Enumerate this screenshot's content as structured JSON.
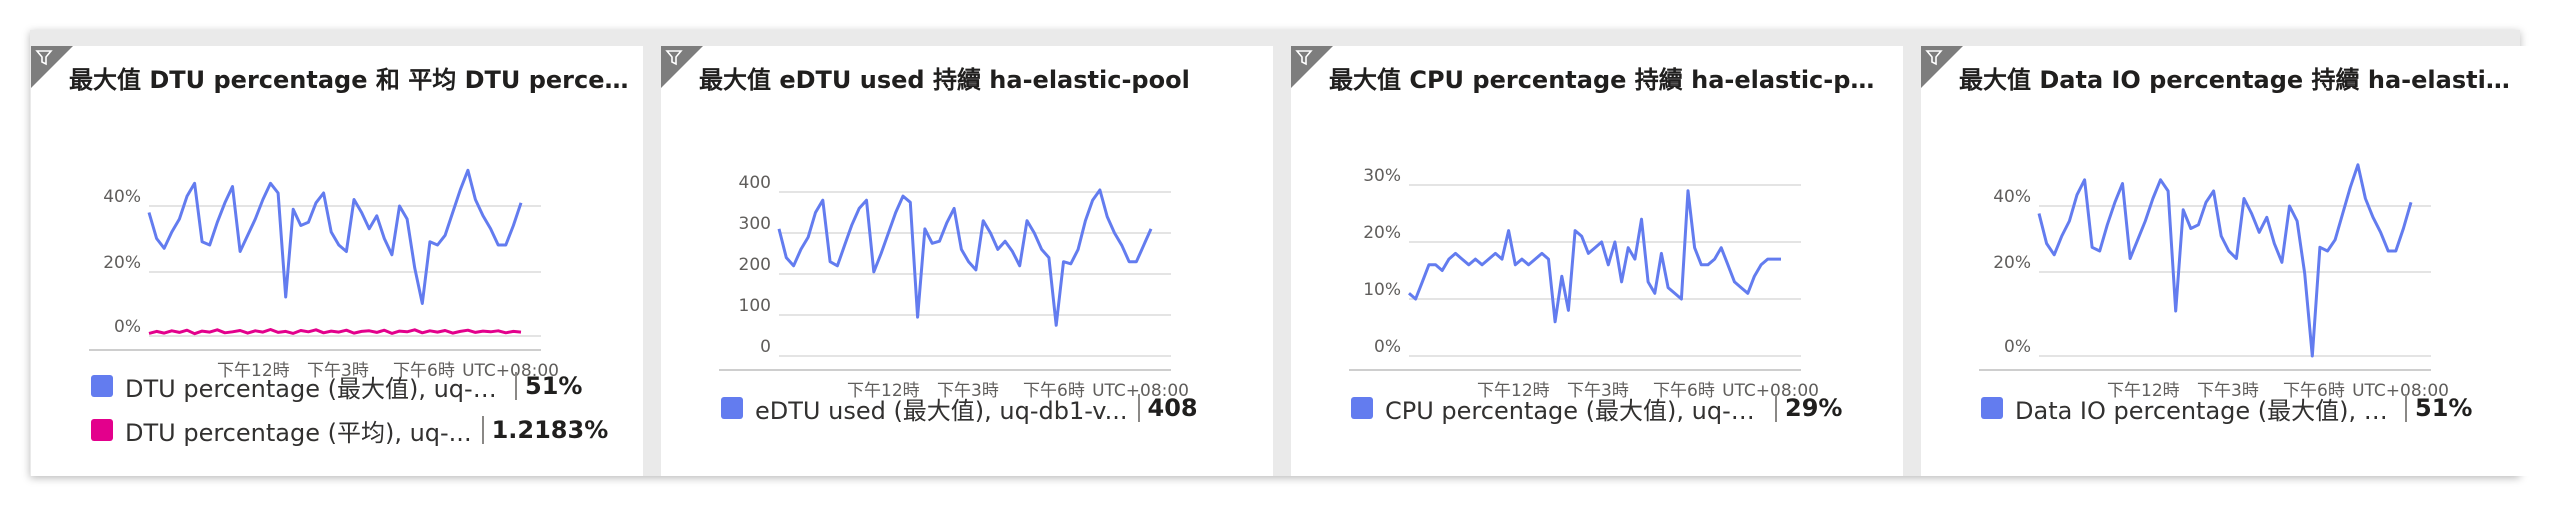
{
  "colors": {
    "series_max": "#637cef",
    "series_avg": "#e3008c",
    "grid": "#dcdcdc",
    "axis": "#bdbdbd",
    "tick": "#605e5c"
  },
  "icons": {
    "tile_filter": "filter-icon"
  },
  "tiles": [
    {
      "title": "最大值 DTU percentage 和 平均 DTU percen...",
      "legend": [
        {
          "name": "DTU percentage (最大值), uq-d...",
          "value": "51%",
          "color": "#637cef"
        },
        {
          "name": "DTU percentage (平均), uq-...",
          "value": "1.2183%",
          "color": "#e3008c"
        }
      ],
      "y_ticks": [
        "40%",
        "20%",
        "0%"
      ],
      "x_ticks": [
        "下午12時",
        "下午3時",
        "下午6時"
      ],
      "timezone": "UTC+08:00"
    },
    {
      "title": "最大值 eDTU used 持續 ha-elastic-pool",
      "legend": [
        {
          "name": "eDTU used (最大值), uq-db1-v...",
          "value": "408",
          "color": "#637cef"
        }
      ],
      "y_ticks": [
        "400",
        "300",
        "200",
        "100",
        "0"
      ],
      "x_ticks": [
        "下午12時",
        "下午3時",
        "下午6時"
      ],
      "timezone": "UTC+08:00"
    },
    {
      "title": "最大值 CPU percentage 持續 ha-elastic-pool",
      "legend": [
        {
          "name": "CPU percentage (最大值), uq-d...",
          "value": "29%",
          "color": "#637cef"
        }
      ],
      "y_ticks": [
        "30%",
        "20%",
        "10%",
        "0%"
      ],
      "x_ticks": [
        "下午12時",
        "下午3時",
        "下午6時"
      ],
      "timezone": "UTC+08:00"
    },
    {
      "title": "最大值 Data IO percentage 持續 ha-elastic-...",
      "legend": [
        {
          "name": "Data IO percentage (最大值), u...",
          "value": "51%",
          "color": "#637cef"
        }
      ],
      "y_ticks": [
        "40%",
        "20%",
        "0%"
      ],
      "x_ticks": [
        "下午12時",
        "下午3時",
        "下午6時"
      ],
      "timezone": "UTC+08:00"
    }
  ],
  "chart_data": [
    {
      "type": "line",
      "title": "最大值 DTU percentage 和 平均 DTU percen...",
      "ylim": [
        0,
        50
      ],
      "series": [
        {
          "name": "DTU percentage (最大值), uq-d...",
          "values": [
            38,
            30,
            27,
            32,
            36,
            43,
            47,
            29,
            28,
            35,
            41,
            46,
            26,
            31,
            36,
            42,
            47,
            44,
            12,
            39,
            34,
            35,
            41,
            44,
            32,
            28,
            26,
            42,
            38,
            33,
            37,
            30,
            25,
            40,
            36,
            21,
            10,
            29,
            28,
            31,
            38,
            45,
            51,
            42,
            37,
            33,
            28,
            28,
            34,
            41
          ]
        },
        {
          "name": "DTU percentage (平均), uq-...",
          "values": [
            0.8,
            1.4,
            0.9,
            1.6,
            1.1,
            1.8,
            0.7,
            1.5,
            1.2,
            1.9,
            1.0,
            1.3,
            1.7,
            0.9,
            1.6,
            1.2,
            2.0,
            1.1,
            1.4,
            0.8,
            1.7,
            1.3,
            1.9,
            1.0,
            1.5,
            1.2,
            1.8,
            0.9,
            1.4,
            1.6,
            1.1,
            1.8,
            0.8,
            1.5,
            1.3,
            1.9,
            1.0,
            1.6,
            1.2,
            1.7,
            0.9,
            1.4,
            1.8,
            1.1,
            1.5,
            1.3,
            1.6,
            1.0,
            1.4,
            1.2
          ]
        }
      ]
    },
    {
      "type": "line",
      "title": "最大值 eDTU used 持續 ha-elastic-pool",
      "ylim": [
        0,
        400
      ],
      "series": [
        {
          "name": "eDTU used (最大值), uq-db1-v...",
          "values": [
            310,
            240,
            220,
            260,
            290,
            350,
            380,
            230,
            220,
            270,
            320,
            360,
            380,
            205,
            250,
            300,
            350,
            390,
            375,
            95,
            310,
            275,
            280,
            325,
            360,
            260,
            230,
            210,
            330,
            300,
            260,
            280,
            255,
            220,
            330,
            300,
            260,
            240,
            75,
            230,
            225,
            260,
            330,
            380,
            405,
            340,
            300,
            270,
            230,
            230,
            270,
            310
          ]
        }
      ]
    },
    {
      "type": "line",
      "title": "最大值 CPU percentage 持續 ha-elastic-pool",
      "ylim": [
        0,
        30
      ],
      "series": [
        {
          "name": "CPU percentage (最大值), uq-d...",
          "values": [
            11,
            10,
            13,
            16,
            16,
            15,
            17,
            18,
            17,
            16,
            17,
            16,
            17,
            18,
            17,
            22,
            16,
            17,
            16,
            17,
            18,
            17,
            6,
            14,
            8,
            22,
            21,
            18,
            19,
            20,
            16,
            20,
            13,
            19,
            17,
            24,
            13,
            11,
            18,
            12,
            11,
            10,
            29,
            19,
            16,
            16,
            17,
            19,
            16,
            13,
            12,
            11,
            14,
            16,
            17,
            17,
            17
          ]
        }
      ]
    },
    {
      "type": "line",
      "title": "最大值 Data IO percentage 持續 ha-elastic-...",
      "ylim": [
        0,
        50
      ],
      "series": [
        {
          "name": "Data IO percentage (最大值), u...",
          "values": [
            38,
            30,
            27,
            32,
            36,
            43,
            47,
            29,
            28,
            35,
            41,
            46,
            26,
            31,
            36,
            42,
            47,
            44,
            12,
            39,
            34,
            35,
            41,
            44,
            32,
            28,
            26,
            42,
            38,
            33,
            37,
            30,
            25,
            40,
            36,
            22,
            0,
            29,
            28,
            31,
            38,
            45,
            51,
            42,
            37,
            33,
            28,
            28,
            34,
            41
          ]
        }
      ]
    }
  ]
}
